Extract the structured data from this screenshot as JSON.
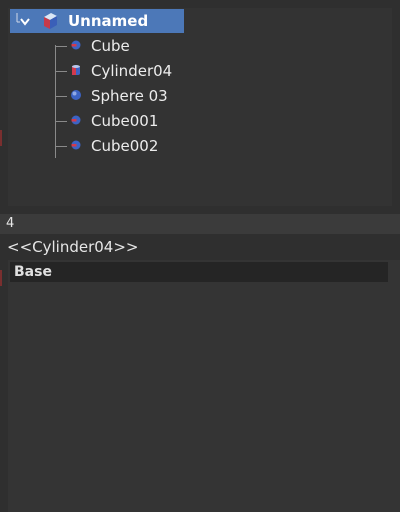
{
  "tree": {
    "root_label": "Unnamed",
    "items": [
      {
        "label": "Cube",
        "icon": "cube-icon"
      },
      {
        "label": "Cylinder04",
        "icon": "cylinder-icon"
      },
      {
        "label": "Sphere 03",
        "icon": "sphere-icon"
      },
      {
        "label": "Cube001",
        "icon": "cube-icon"
      },
      {
        "label": "Cube002",
        "icon": "cube-icon"
      }
    ]
  },
  "splitter": {
    "text": "4"
  },
  "properties": {
    "object_name": "<<Cylinder04>>",
    "group_label": "Base"
  },
  "colors": {
    "selection": "#4c78b8",
    "background": "#2f2f2f",
    "panel": "#333333",
    "text": "#e6e6e6"
  }
}
